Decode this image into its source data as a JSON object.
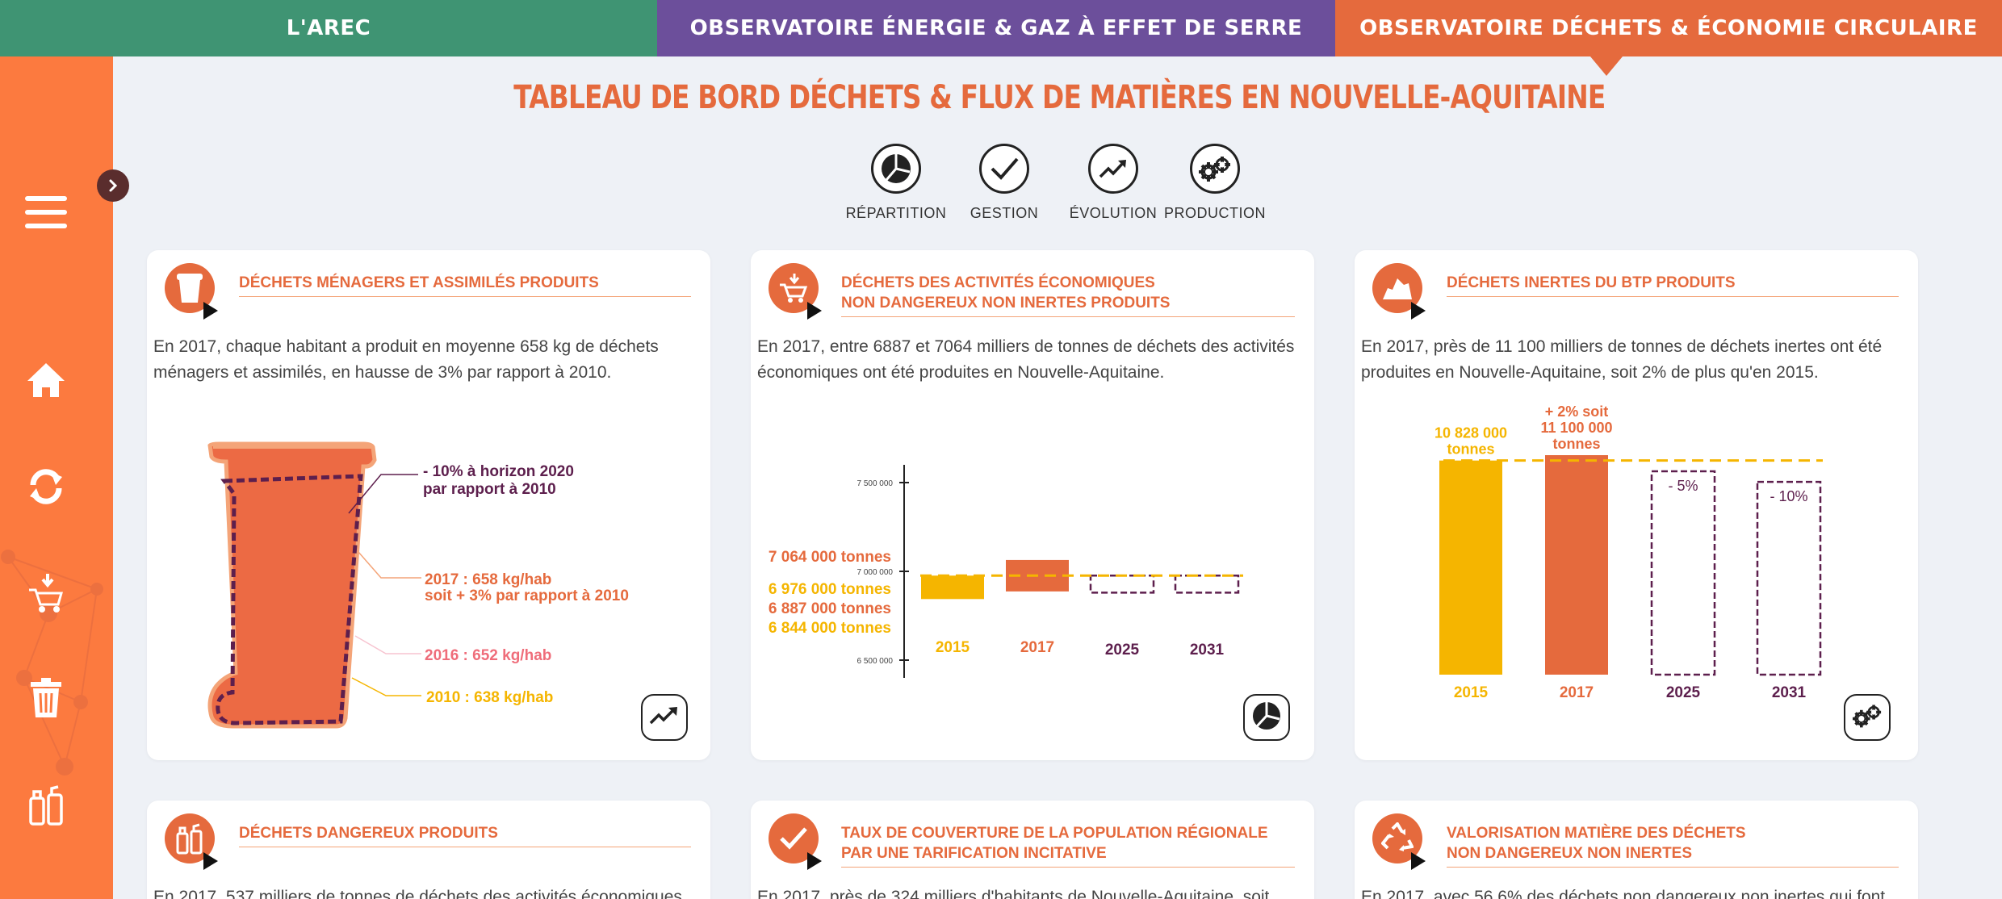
{
  "nav": {
    "tabs": [
      {
        "label": "L'AREC"
      },
      {
        "label": "OBSERVATOIRE ÉNERGIE & GAZ À EFFET DE SERRE"
      },
      {
        "label": "OBSERVATOIRE DÉCHETS & ÉCONOMIE CIRCULAIRE"
      }
    ],
    "active_color": "#e56a3d"
  },
  "page": {
    "title": "TABLEAU DE BORD DÉCHETS & FLUX DE MATIÈRES EN NOUVELLE-AQUITAINE"
  },
  "categories": [
    {
      "label": "RÉPARTITION",
      "icon": "pie-chart-icon"
    },
    {
      "label": "GESTION",
      "icon": "checkmark-icon"
    },
    {
      "label": "ÉVOLUTION",
      "icon": "trend-icon"
    },
    {
      "label": "PRODUCTION",
      "icon": "gears-icon"
    }
  ],
  "sidebar": {
    "color": "#fc7a3f",
    "icons": [
      "menu-icon",
      "home-icon",
      "refresh-icon",
      "cart-icon",
      "trash-icon",
      "spray-icon"
    ]
  },
  "colors": {
    "orange": "#e56a3d",
    "yellow": "#f5b500",
    "purple": "#5d1f4d",
    "pink": "#ef6d7a"
  },
  "cards": [
    {
      "title": "DÉCHETS MÉNAGERS ET ASSIMILÉS PRODUITS",
      "text": "En 2017, chaque habitant a produit en moyenne 658 kg de déchets ménagers et assimilés, en hausse de 3% par rapport à 2010.",
      "bin": {
        "target_line1": "- 10% à horizon 2020",
        "target_line2": "par rapport à 2010",
        "y2017_line1": "2017 : 658 kg/hab",
        "y2017_line2": "soit + 3% par rapport à 2010",
        "y2016": "2016 : 652 kg/hab",
        "y2010": "2010 : 638 kg/hab"
      }
    },
    {
      "title_line1": "DÉCHETS DES ACTIVITÉS ÉCONOMIQUES",
      "title_line2": "NON DANGEREUX NON INERTES PRODUITS",
      "text": "En 2017, entre 6887 et 7064 milliers de tonnes de déchets des activités économiques ont été produites en Nouvelle-Aquitaine."
    },
    {
      "title": "DÉCHETS INERTES DU BTP PRODUITS",
      "text": "En 2017, près de 11 100 milliers de tonnes de déchets inertes ont été produites en Nouvelle-Aquitaine, soit 2% de plus qu'en 2015."
    },
    {
      "title": "DÉCHETS DANGEREUX PRODUITS",
      "text": "En 2017, 537 milliers de tonnes de déchets des activités économiques"
    },
    {
      "title_line1": "TAUX DE COUVERTURE DE LA POPULATION RÉGIONALE",
      "title_line2": "PAR UNE TARIFICATION INCITATIVE",
      "text": "En 2017, près de 324 milliers d'habitants de Nouvelle-Aquitaine, soit"
    },
    {
      "title_line1": "VALORISATION MATIÈRE DES DÉCHETS",
      "title_line2": "NON DANGEREUX NON INERTES",
      "text": "En 2017, avec 56,6% des déchets non dangereux non inertes qui font"
    }
  ],
  "chart_data": [
    {
      "type": "bar",
      "categories": [
        "2015",
        "2017",
        "2025",
        "2031"
      ],
      "ylim": [
        6400000,
        7600000
      ],
      "y_ticks": [
        "7 500 000",
        "7 000 000",
        "6 500 000"
      ],
      "baseline": 6976000,
      "series": [
        {
          "values": [
            6844000,
            7064000,
            null,
            null
          ],
          "low": [
            6844000,
            6887000,
            null,
            null
          ],
          "colors": [
            "#f5b500",
            "#e56a3d"
          ]
        },
        {
          "values": [
            null,
            null,
            6976000,
            6976000
          ],
          "style": "dashed-outline"
        }
      ],
      "labels": [
        {
          "text": "7 064 000 tonnes",
          "color": "#e56a3d"
        },
        {
          "text": "6 976 000 tonnes",
          "color": "#f5b500"
        },
        {
          "text": "6 887 000 tonnes",
          "color": "#e56a3d"
        },
        {
          "text": "6 844 000 tonnes",
          "color": "#f5b500"
        }
      ]
    },
    {
      "type": "bar",
      "categories": [
        "2015",
        "2017",
        "2025",
        "2031"
      ],
      "values": [
        10828000,
        11100000,
        10282000,
        9750000
      ],
      "styles": [
        "solid",
        "solid",
        "dashed-outline",
        "dashed-outline"
      ],
      "colors": [
        "#f5b500",
        "#e56a3d",
        "#5d1f4d",
        "#5d1f4d"
      ],
      "bar_labels": [
        [
          "10 828 000",
          "tonnes"
        ],
        [
          "+ 2% soit",
          "11 100 000",
          "tonnes"
        ],
        [
          "- 5%"
        ],
        [
          "- 10%"
        ]
      ]
    }
  ]
}
